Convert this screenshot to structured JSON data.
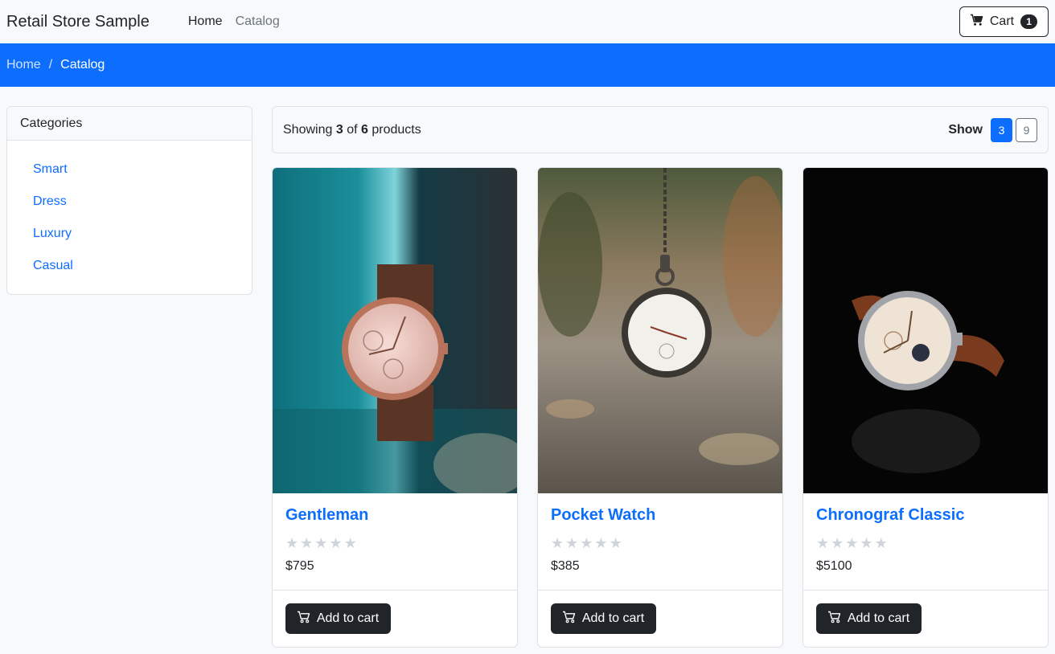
{
  "navbar": {
    "brand": "Retail Store Sample",
    "links": [
      {
        "label": "Home"
      },
      {
        "label": "Catalog"
      }
    ],
    "cart": {
      "label": "Cart",
      "count": "1",
      "icon": "cart-icon"
    }
  },
  "breadcrumb": {
    "home": "Home",
    "separator": "/",
    "current": "Catalog"
  },
  "sidebar": {
    "title": "Categories",
    "items": [
      {
        "label": "Smart"
      },
      {
        "label": "Dress"
      },
      {
        "label": "Luxury"
      },
      {
        "label": "Casual"
      }
    ]
  },
  "toolbar": {
    "showing_prefix": "Showing",
    "showing_count": "3",
    "of": "of",
    "total": "6",
    "suffix": "products",
    "show_label": "Show",
    "page_sizes": [
      "3",
      "9"
    ],
    "selected_page_size": "3"
  },
  "products": [
    {
      "name": "Gentleman",
      "price": "$795",
      "rating": 0,
      "button": "Add to cart"
    },
    {
      "name": "Pocket Watch",
      "price": "$385",
      "rating": 0,
      "button": "Add to cart"
    },
    {
      "name": "Chronograf Classic",
      "price": "$5100",
      "rating": 0,
      "button": "Add to cart"
    }
  ],
  "colors": {
    "primary": "#0d6efd",
    "dark": "#212529",
    "muted": "#6c757d",
    "star_empty": "#ced4da"
  }
}
